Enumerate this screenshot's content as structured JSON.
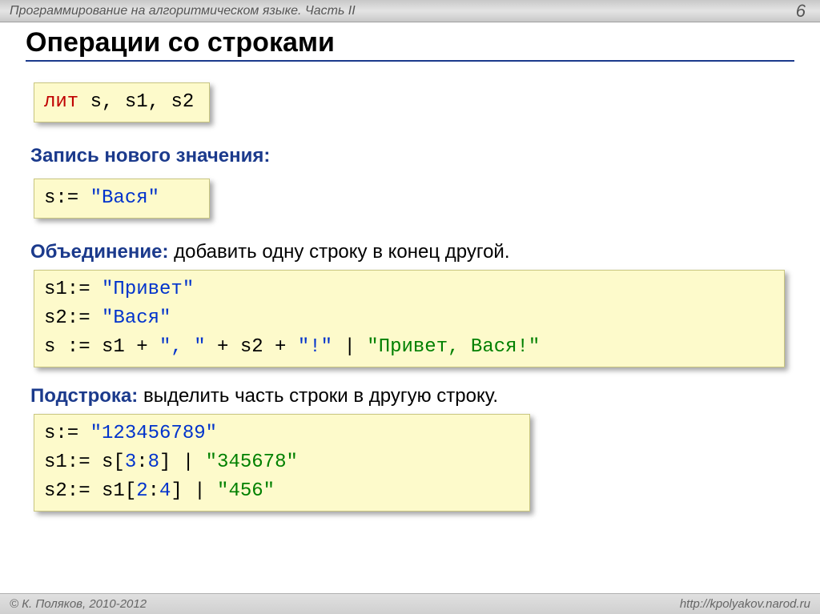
{
  "header": {
    "title": "Программирование на алгоритмическом языке. Часть II",
    "page_number": "6"
  },
  "slide": {
    "title": "Операции со строками",
    "declaration": {
      "keyword": "лит",
      "vars": " s, s1, s2"
    },
    "section_assign": {
      "label": "Запись нового значения:",
      "code": {
        "lhs": "s:= ",
        "val": "\"Вася\""
      }
    },
    "section_concat": {
      "label": "Объединение:",
      "rest": " добавить одну строку в конец другой.",
      "code": {
        "l1a": "s1:= ",
        "l1b": "\"Привет\"",
        "l2a": "s2:= ",
        "l2b": "\"Вася\"",
        "l3a": "s := s1 + ",
        "l3b": "\", \"",
        "l3c": " + s2 + ",
        "l3d": "\"!\"",
        "l3e": "  | ",
        "l3f": "\"Привет, Вася!\""
      }
    },
    "section_substr": {
      "label": "Подстрока:",
      "rest": " выделить часть строки в другую строку.",
      "code": {
        "l1a": "s:= ",
        "l1b": "\"123456789\"",
        "l2a": "s1:= s[",
        "l2b": "3",
        "l2c": ":",
        "l2d": "8",
        "l2e": "]    | ",
        "l2f": "\"345678\"",
        "l3a": "s2:= s1[",
        "l3b": "2",
        "l3c": ":",
        "l3d": "4",
        "l3e": "]   | ",
        "l3f": "\"456\""
      }
    }
  },
  "footer": {
    "copyright": "© К. Поляков, 2010-2012",
    "url": "http://kpolyakov.narod.ru"
  }
}
